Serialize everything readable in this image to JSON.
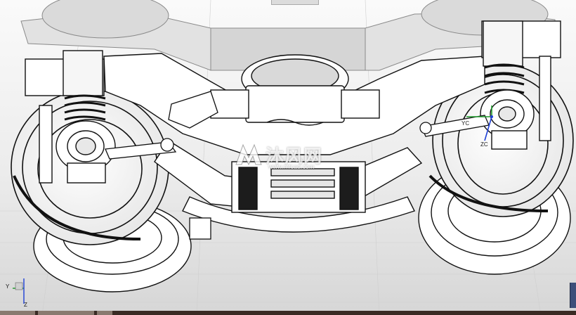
{
  "viewport": {
    "background": "#f0f0f0",
    "line_color": "#111111",
    "fill_color": "#ffffff"
  },
  "axis_triad_main": {
    "x_label": "YC",
    "y_label": "ZC"
  },
  "axis_triad_corner": {
    "y_label": "Y",
    "z_label": "Z"
  },
  "watermark": {
    "text": "沐风网",
    "url": "www.mfcad.com"
  },
  "colors": {
    "axis_green": "#1d9a2a",
    "axis_blue": "#1d3fd6",
    "scroll_blue": "#3d4f7a",
    "bottom_bar": "#3a2b24"
  }
}
